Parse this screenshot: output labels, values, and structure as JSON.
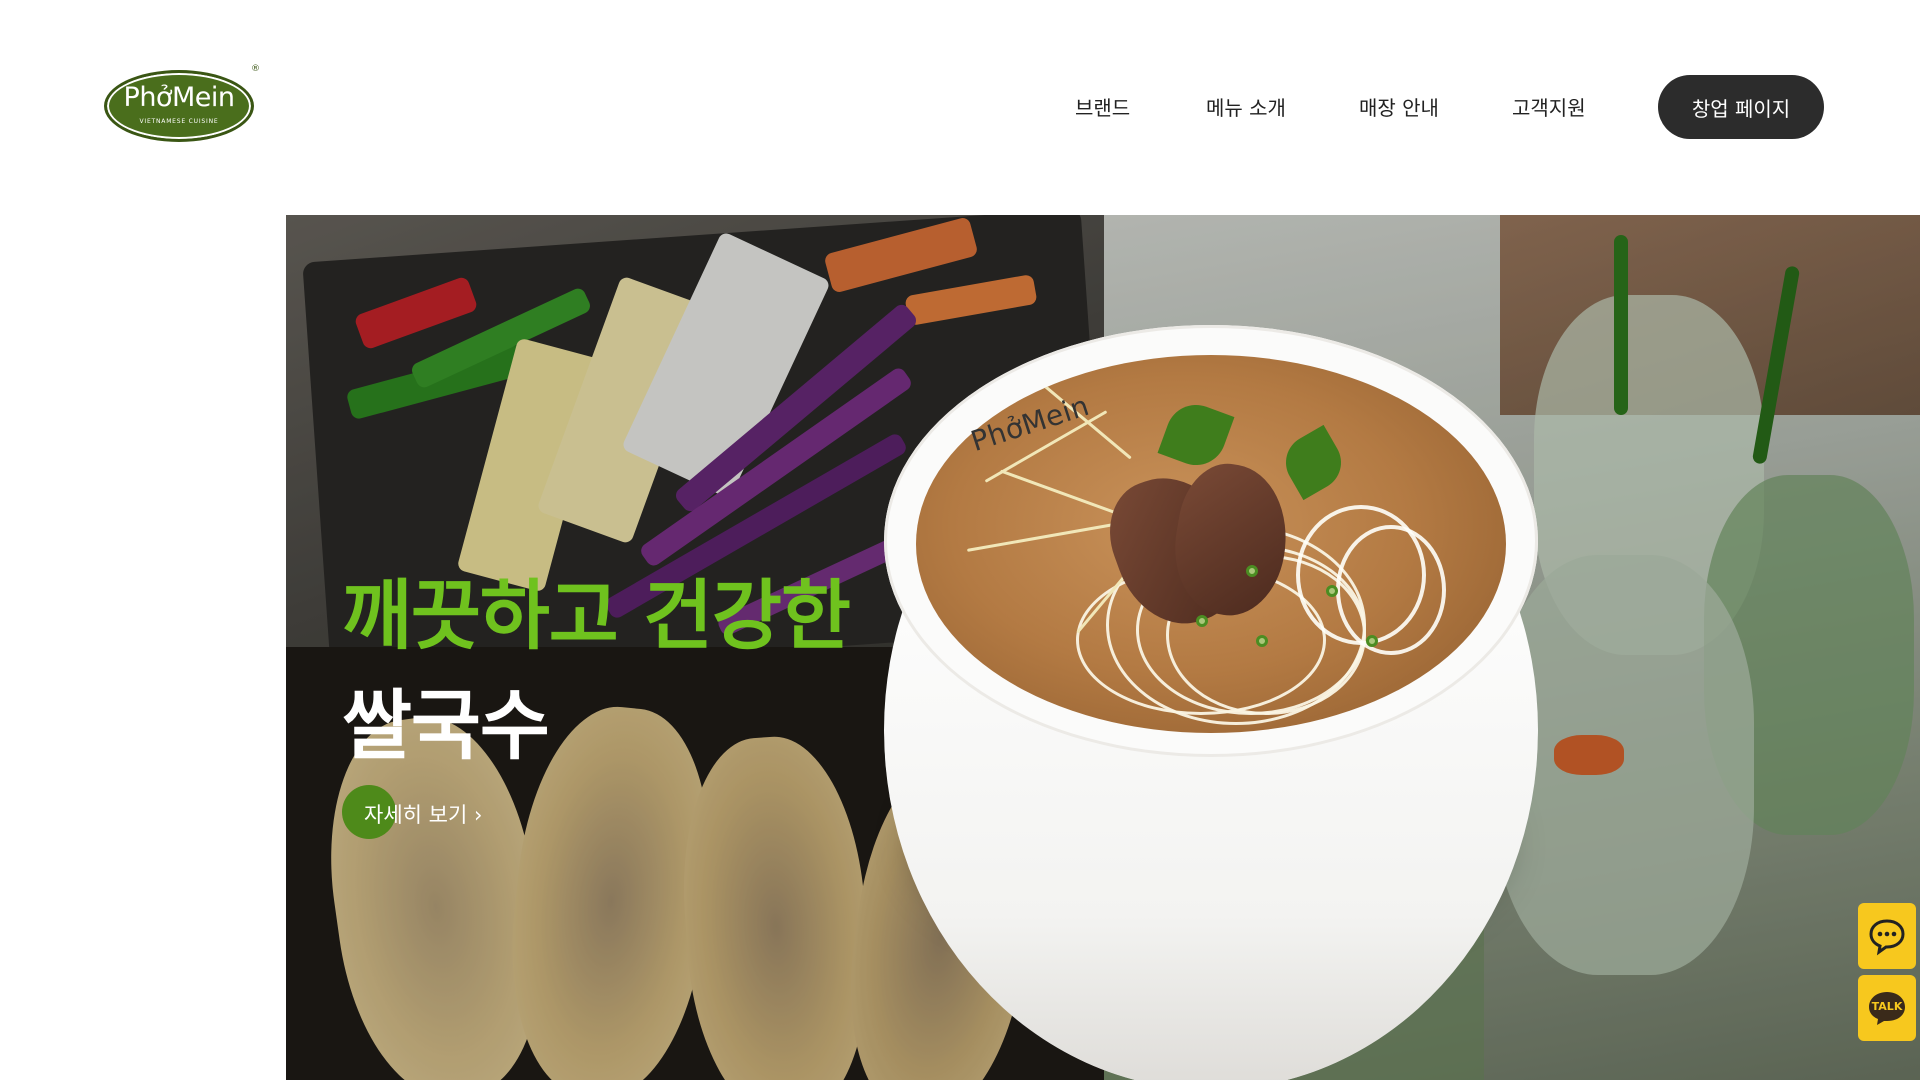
{
  "header": {
    "logo": {
      "name": "PhởMein",
      "sub": "VIETNAMESE CUISINE",
      "reg": "®"
    },
    "nav": [
      {
        "label": "브랜드"
      },
      {
        "label": "메뉴 소개"
      },
      {
        "label": "매장 안내"
      },
      {
        "label": "고객지원"
      }
    ],
    "cta_label": "창업 페이지"
  },
  "hero": {
    "headline_green": "깨끗하고 건강한",
    "headline_white": "쌀국수",
    "more_label": "자세히 보기 ›",
    "bowl_brand": "PhởMein",
    "colors": {
      "accent_green": "#6fc21e",
      "button_green": "#4e8a1a",
      "cta_dark": "#2c2c2c"
    }
  },
  "floating": {
    "chat_icon": "chat-bubble-icon",
    "talk_label": "TALK",
    "color": "#f7c81e"
  }
}
